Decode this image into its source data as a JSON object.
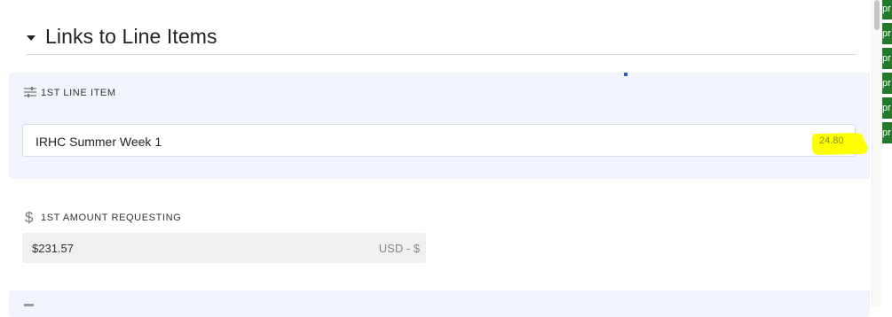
{
  "section": {
    "title": "Links to Line Items"
  },
  "line_item": {
    "label": "1ST LINE ITEM",
    "value": "IRHC Summer Week 1",
    "highlight_text": "24.80",
    "highlight_color": "#ffff00"
  },
  "amount": {
    "label": "1ST AMOUNT REQUESTING",
    "value": "$231.57",
    "unit": "USD - $"
  },
  "right_edge_tabs": [
    "pr",
    "pr",
    "pr",
    "pr",
    "pr",
    "pr"
  ],
  "colors": {
    "panel_bg": "#f1f5fb",
    "right_tab": "#237a2b"
  }
}
